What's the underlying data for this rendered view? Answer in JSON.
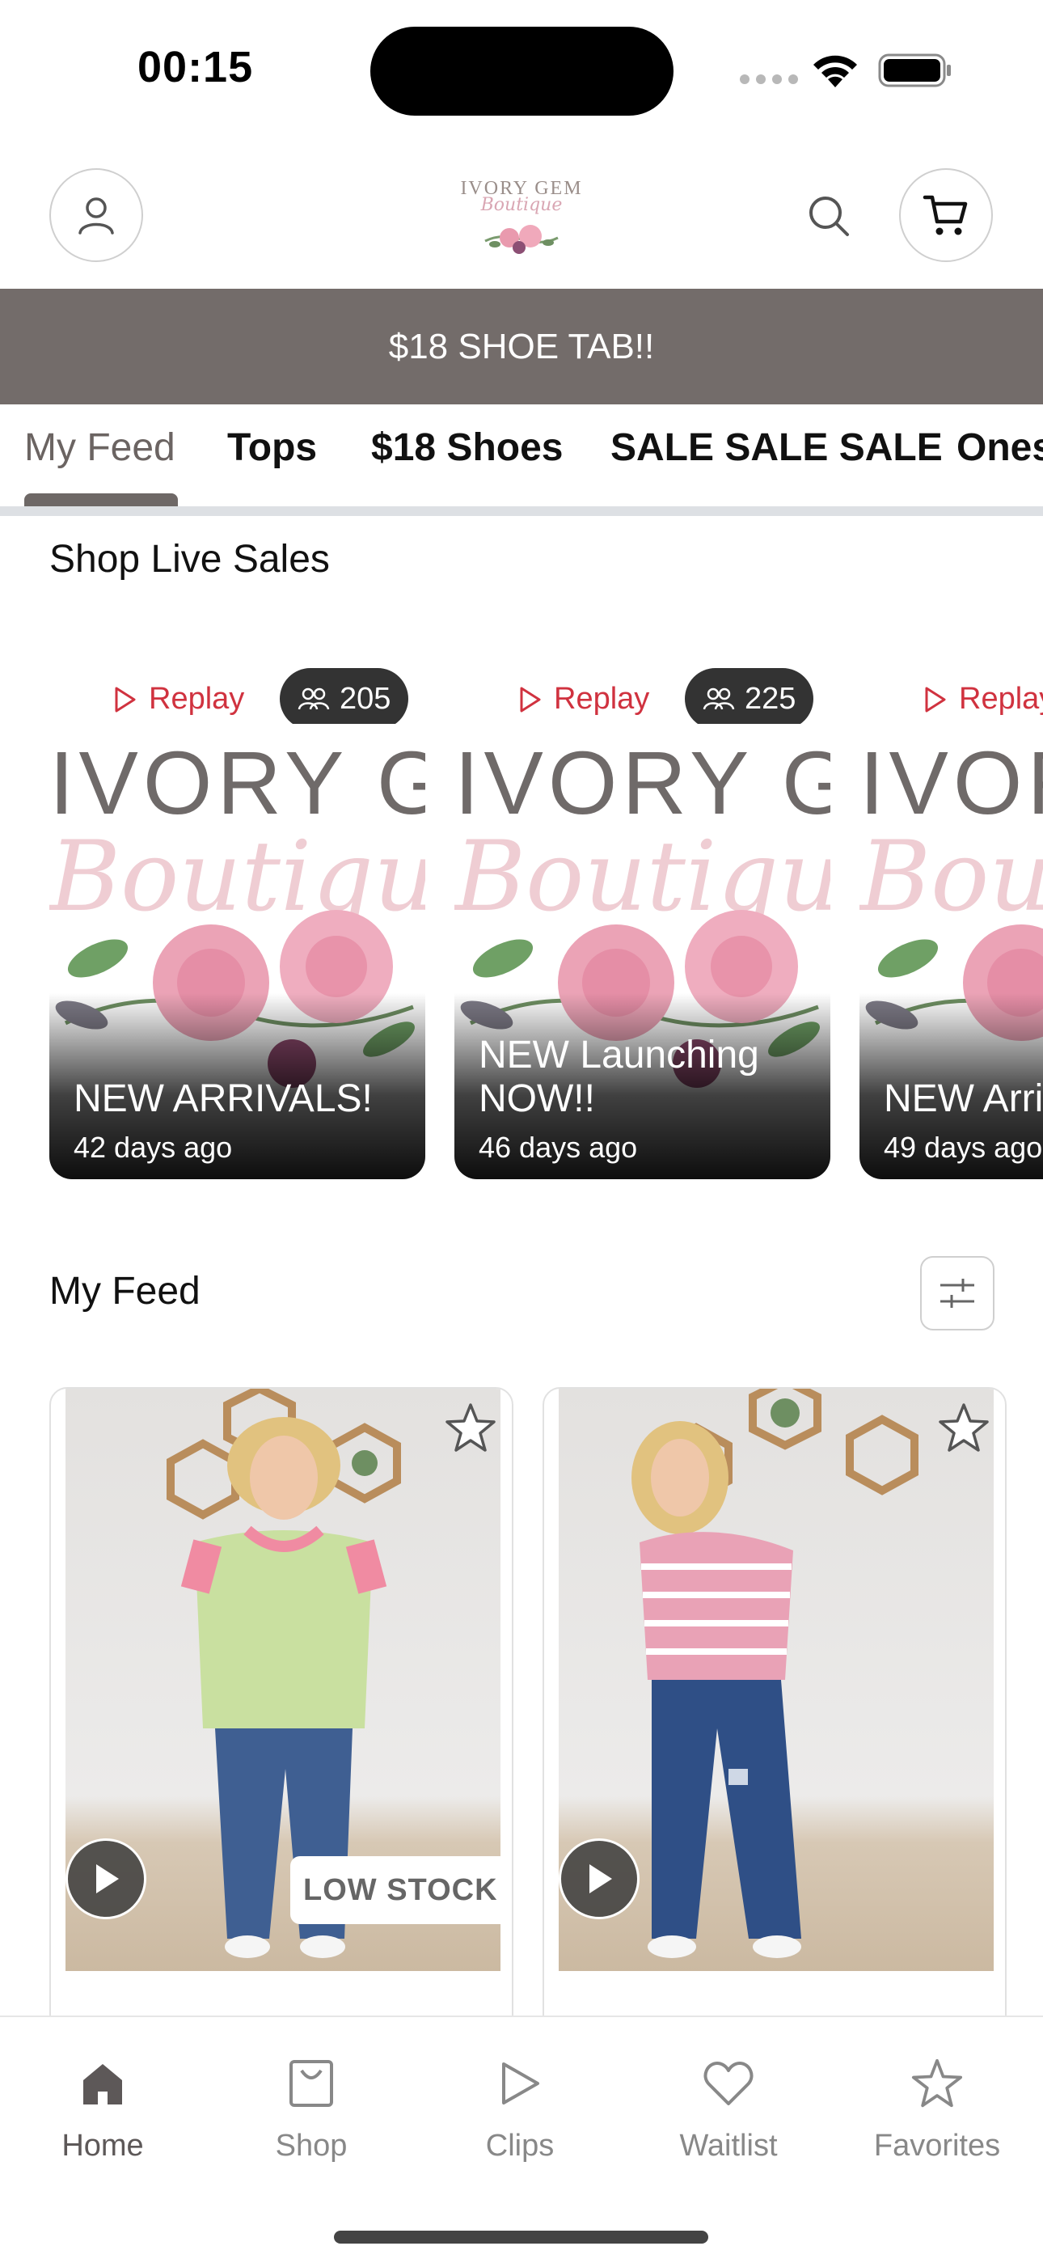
{
  "status_bar": {
    "time": "00:15"
  },
  "header": {
    "logo_top": "IVORY GEM",
    "logo_script": "Boutique"
  },
  "banner": {
    "text": "$18 SHOE TAB!!"
  },
  "tabs": [
    {
      "label": "My Feed",
      "active": true
    },
    {
      "label": "Tops"
    },
    {
      "label": "$18 Shoes"
    },
    {
      "label": "SALE SALE SALE"
    },
    {
      "label": "Ones"
    }
  ],
  "live_sales": {
    "title": "Shop Live Sales",
    "replay_label": "Replay",
    "thumb_brand": "IVORY GEM",
    "thumb_script": "Boutique",
    "cards": [
      {
        "title": "NEW ARRIVALS!",
        "age": "42 days ago",
        "viewers": "205"
      },
      {
        "title": "NEW Launching NOW!!",
        "age": "46 days ago",
        "viewers": "225"
      },
      {
        "title": "NEW Arri",
        "age": "49 days ago"
      }
    ]
  },
  "feed": {
    "title": "My Feed",
    "products": [
      {
        "badge": "LOW STOCK",
        "shirt_color": "#c9e0a0",
        "trim_color": "#f08ba2"
      },
      {
        "badge": "",
        "shirt_color": "#e9a2b6",
        "trim_color": "#ffffff"
      }
    ]
  },
  "bottom_nav": [
    {
      "label": "Home",
      "icon": "home-icon",
      "active": true
    },
    {
      "label": "Shop",
      "icon": "shopping-bag-icon"
    },
    {
      "label": "Clips",
      "icon": "play-icon"
    },
    {
      "label": "Waitlist",
      "icon": "heart-icon"
    },
    {
      "label": "Favorites",
      "icon": "star-icon"
    }
  ],
  "colors": {
    "banner_bg": "#736c6a",
    "replay_red": "#d0323f",
    "accent_gray": "#6e6866"
  }
}
